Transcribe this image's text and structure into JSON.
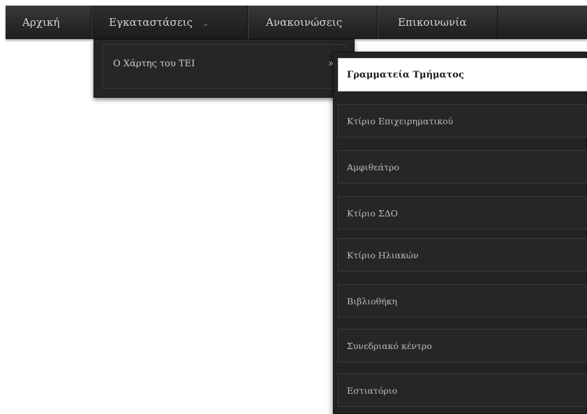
{
  "menubar": {
    "items": [
      {
        "label": "Αρχική"
      },
      {
        "label": "Εγκαταστάσεις",
        "chevron": "⌄"
      },
      {
        "label": "Ανακοινώσεις"
      },
      {
        "label": "Επικοινωνία"
      }
    ]
  },
  "dropdown": {
    "item_label": "Ο Χάρτης του ΤΕΙ",
    "arrow": "»"
  },
  "submenu": {
    "items": [
      {
        "label": "Γραμματεία Τμήματος"
      },
      {
        "label": "Κτίριο Επιχειρηματικού"
      },
      {
        "label": "Αμφιθεάτρο"
      },
      {
        "label": "Κτίριο ΣΔΟ"
      },
      {
        "label": "Κτίριο Ηλιακών"
      },
      {
        "label": "Βιβλιοθήκη"
      },
      {
        "label": "Συνεδριακό κέντρο"
      },
      {
        "label": "Εστιατόριο"
      }
    ]
  },
  "colors": {
    "menubar_bg": "#2a2a2a",
    "menu_text": "#d8d8d8",
    "submenu_bg": "#262626",
    "active_bg": "#ffffff",
    "active_text": "#1a1a1a"
  }
}
